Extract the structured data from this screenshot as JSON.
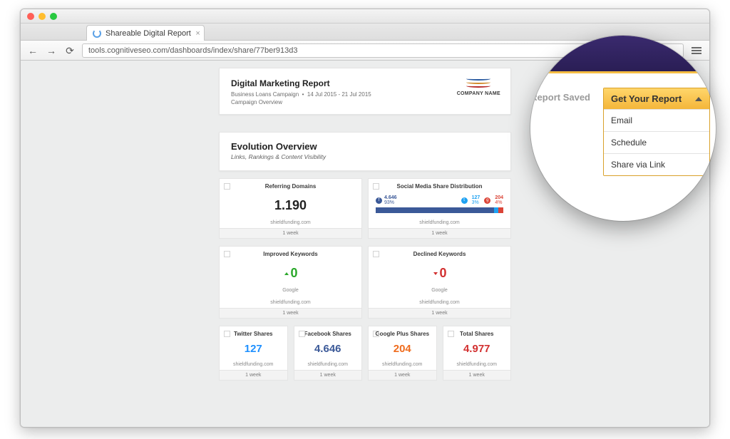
{
  "browser": {
    "tab_title": "Shareable Digital Report",
    "url": "tools.cognitiveseo.com/dashboards/index/share/77ber913d3"
  },
  "header": {
    "title": "Digital Marketing Report",
    "campaign": "Business Loans Campaign",
    "daterange": "14 Jul 2015 - 21 Jul 2015",
    "subtitle": "Campaign Overview",
    "logo_label": "COMPANY NAME"
  },
  "section": {
    "title": "Evolution Overview",
    "subtitle": "Links, Rankings & Content Visibility"
  },
  "common": {
    "site": "shieldfunding.com",
    "period": "1 week",
    "google": "Google"
  },
  "widgets": {
    "referring_domains": {
      "title": "Referring Domains",
      "value": "1.190"
    },
    "social_dist": {
      "title": "Social Media Share Distribution",
      "fb_value": "4.646",
      "fb_pct": "93%",
      "tw_value": "127",
      "tw_pct": "3%",
      "gp_value": "204",
      "gp_pct": "4%"
    },
    "improved_kw": {
      "title": "Improved Keywords",
      "value": "0"
    },
    "declined_kw": {
      "title": "Declined Keywords",
      "value": "0"
    },
    "twitter_shares": {
      "title": "Twitter Shares",
      "value": "127"
    },
    "facebook_shares": {
      "title": "Facebook Shares",
      "value": "4.646"
    },
    "google_plus_shares": {
      "title": "Google Plus Shares",
      "value": "204"
    },
    "total_shares": {
      "title": "Total Shares",
      "value": "4.977"
    }
  },
  "magnifier": {
    "saved_label": "Report Saved",
    "button": "Get Your Report",
    "items": [
      "Email",
      "Schedule",
      "Share via Link"
    ]
  }
}
